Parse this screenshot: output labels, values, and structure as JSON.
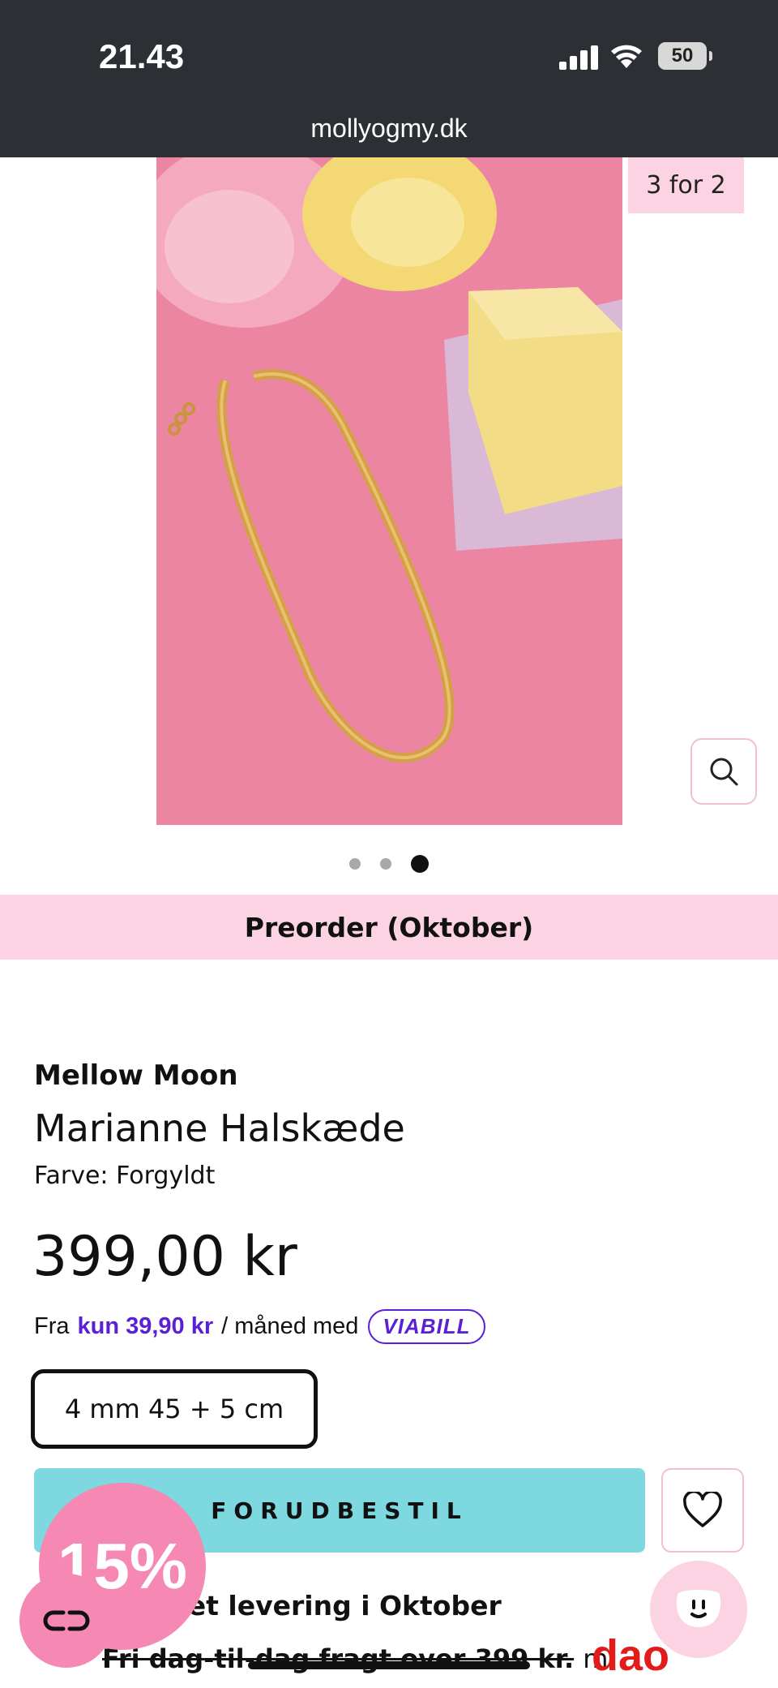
{
  "status_bar": {
    "time": "21.43",
    "battery": "50"
  },
  "browser": {
    "url": "mollyogmy.dk"
  },
  "product_image": {
    "promo_badge": "3 for 2",
    "carousel_count": 3,
    "active_slide": 3
  },
  "banner": {
    "text": "Preorder (Oktober)"
  },
  "product": {
    "brand": "Mellow Moon",
    "title": "Marianne Halskæde",
    "color_label": "Farve: Forgyldt",
    "price": "399,00 kr",
    "installment": {
      "prefix": "Fra",
      "amount": "kun 39,90 kr",
      "suffix": "/ måned med",
      "provider": "VIABILL"
    },
    "size_option": "4 mm 45 + 5 cm",
    "cta": "FORUDBESTIL"
  },
  "delivery": {
    "text": "tet levering i Oktober",
    "shipping_text": "Fri dag-til-dag fragt over 399 kr.",
    "shipping_suffix": "m.",
    "carrier": "dao"
  },
  "overlays": {
    "discount": "15%"
  },
  "colors": {
    "accent_pink": "#fbd3e3",
    "cta_cyan": "#7dd8e0",
    "viabill_purple": "#5a1fd6",
    "dao_red": "#e21b1b"
  }
}
